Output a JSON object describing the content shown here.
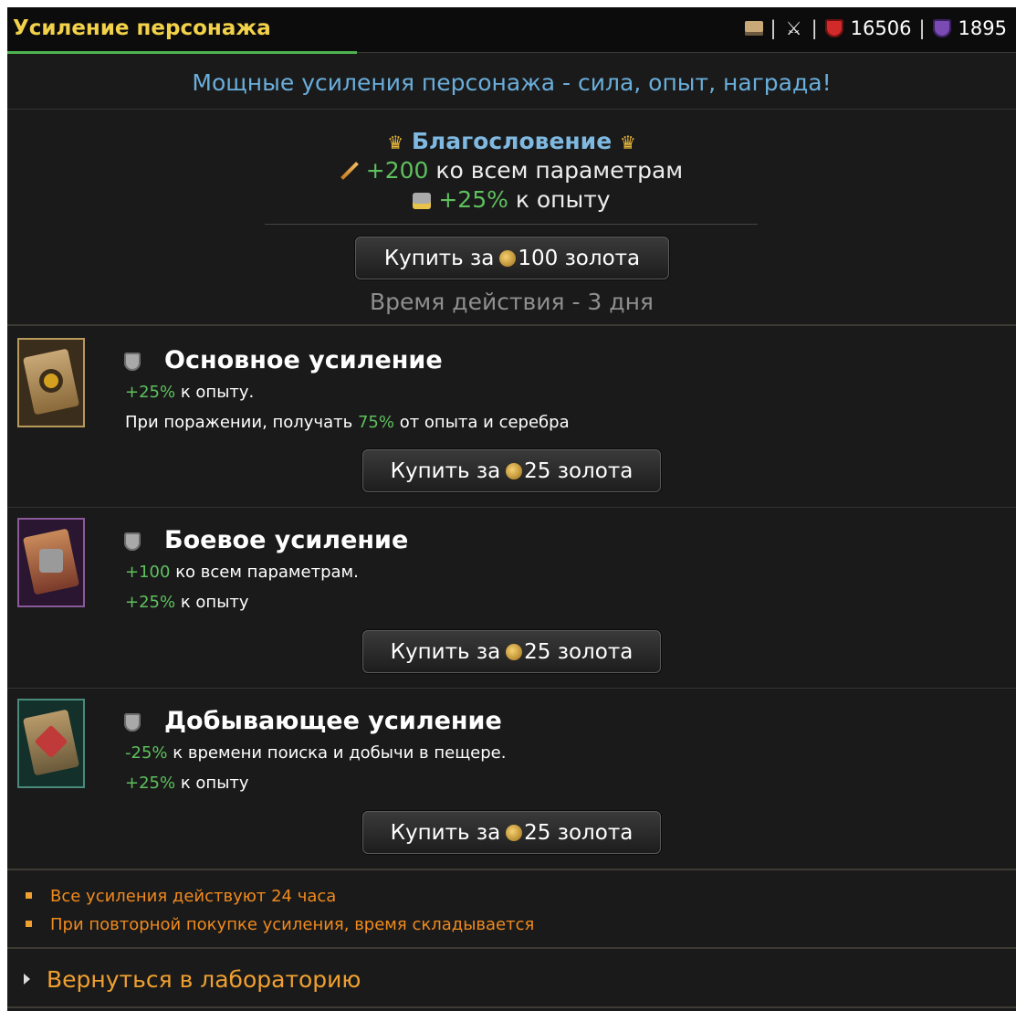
{
  "header": {
    "title": "Усиление персонажа",
    "mail_icon": "mail-icon",
    "battles_icon": "crossed-swords-icon",
    "health_icon": "red-shield-icon",
    "health_value": "16506",
    "energy_icon": "purple-shield-icon",
    "energy_value": "1895",
    "separator": "|"
  },
  "subtitle": "Мощные усиления персонажа - сила, опыт, награда!",
  "blessing": {
    "title": "Благословение",
    "params_value": "+200",
    "params_text": "ко всем параметрам",
    "xp_value": "+25%",
    "xp_text": "к опыту",
    "buy_prefix": "Купить за",
    "buy_price": "100 золота",
    "duration": "Время действия - 3 дня"
  },
  "boosts": [
    {
      "name": "Основное усиление",
      "line1_value": "+25%",
      "line1_text": "к опыту.",
      "line2_prefix": "При поражении, получать",
      "line2_value": "75%",
      "line2_suffix": "от опыта и серебра",
      "buy_prefix": "Купить за",
      "buy_price": "25 золота"
    },
    {
      "name": "Боевое усиление",
      "line1_value": "+100",
      "line1_text": "ко всем параметрам.",
      "line2_value": "+25%",
      "line2_text": "к опыту",
      "buy_prefix": "Купить за",
      "buy_price": "25 золота"
    },
    {
      "name": "Добывающее усиление",
      "line1_value": "-25%",
      "line1_text": "к времени поиска и добычи в пещере.",
      "line2_value": "+25%",
      "line2_text": "к опыту",
      "buy_prefix": "Купить за",
      "buy_price": "25 золота"
    }
  ],
  "notes": [
    "Все усиления действуют 24 часа",
    "При повторной покупке усиления, время складывается"
  ],
  "back_link": "Вернуться в лабораторию",
  "colors": {
    "title_yellow": "#f2d24a",
    "accent_blue": "#6aaedb",
    "value_green": "#5ec05e",
    "note_orange": "#f08a1e"
  }
}
